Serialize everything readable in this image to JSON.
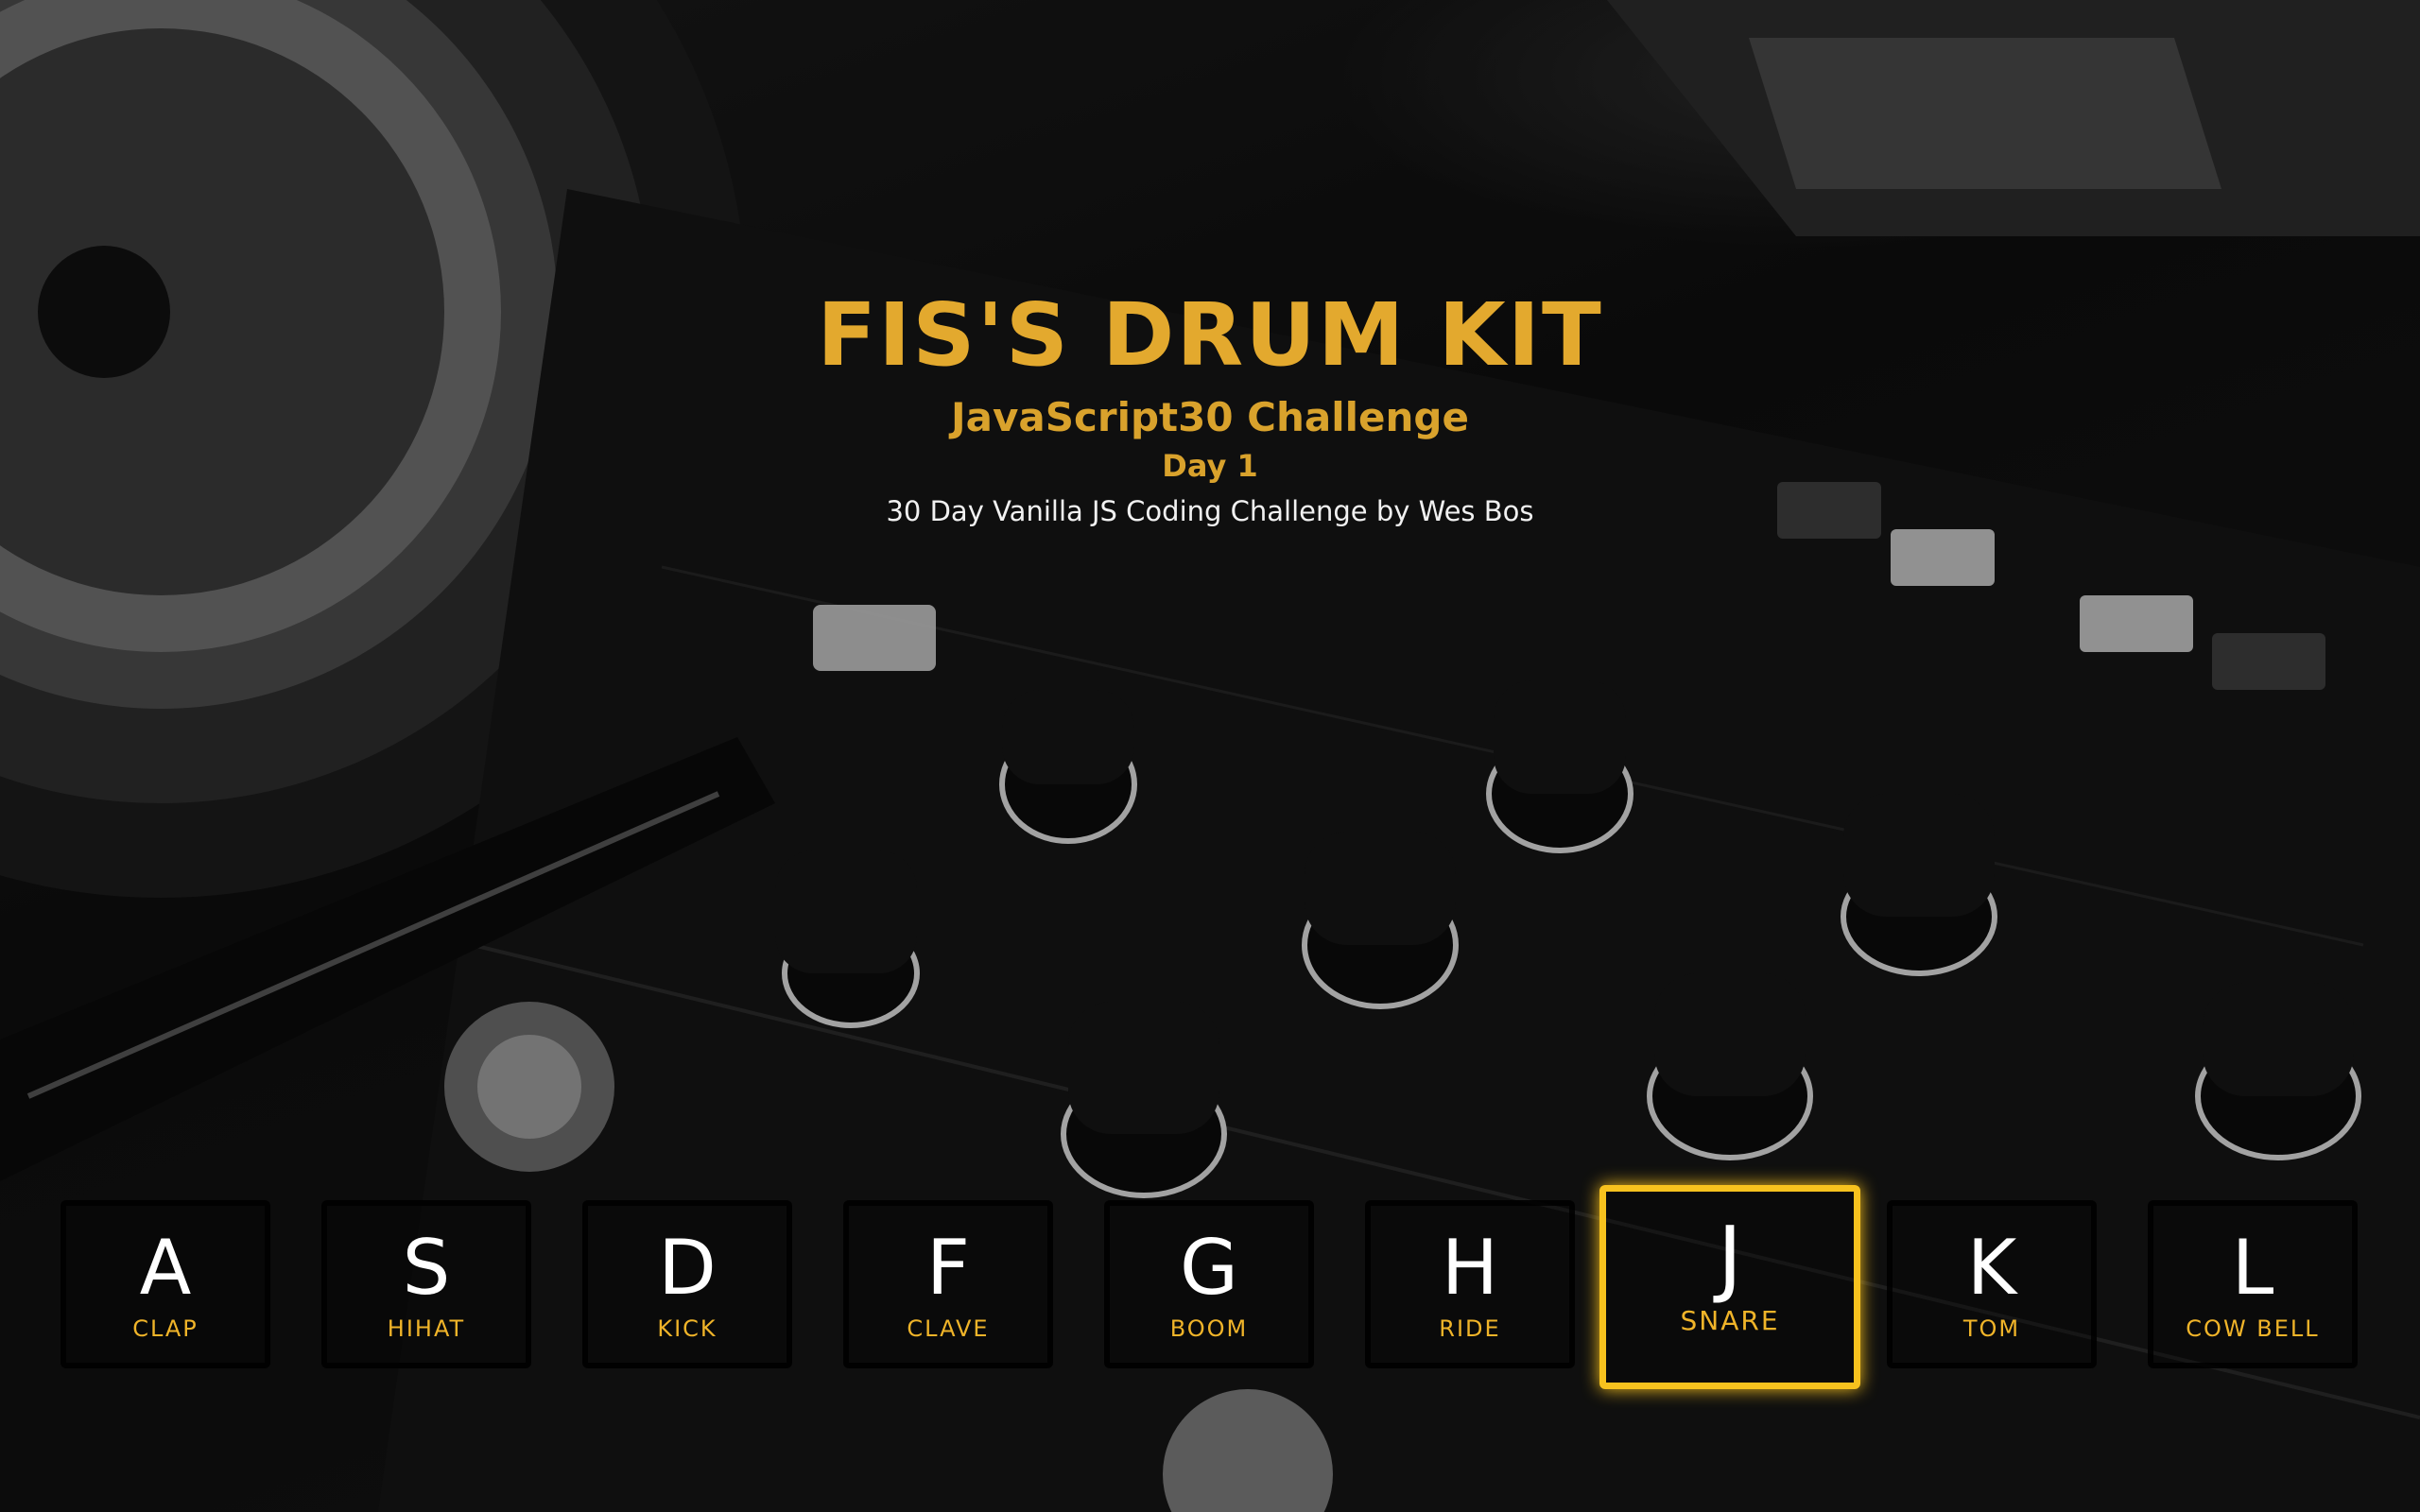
{
  "header": {
    "title": "FIS'S DRUM KIT",
    "subtitle": "JavaScript30 Challenge",
    "day": "Day 1",
    "credit": "30 Day Vanilla JS Coding Challenge by Wes Bos"
  },
  "keys": [
    {
      "letter": "A",
      "sound": "CLAP",
      "playing": false
    },
    {
      "letter": "S",
      "sound": "HIHAT",
      "playing": false
    },
    {
      "letter": "D",
      "sound": "KICK",
      "playing": false
    },
    {
      "letter": "F",
      "sound": "CLAVE",
      "playing": false
    },
    {
      "letter": "G",
      "sound": "BOOM",
      "playing": false
    },
    {
      "letter": "H",
      "sound": "RIDE",
      "playing": false
    },
    {
      "letter": "J",
      "sound": "SNARE",
      "playing": true
    },
    {
      "letter": "K",
      "sound": "TOM",
      "playing": false
    },
    {
      "letter": "L",
      "sound": "COW BELL",
      "playing": false
    }
  ],
  "colors": {
    "accent": "#e3a92e",
    "playing_border": "#f7c21e",
    "label": "#f0b429"
  },
  "background": "dj-mixer-photo"
}
